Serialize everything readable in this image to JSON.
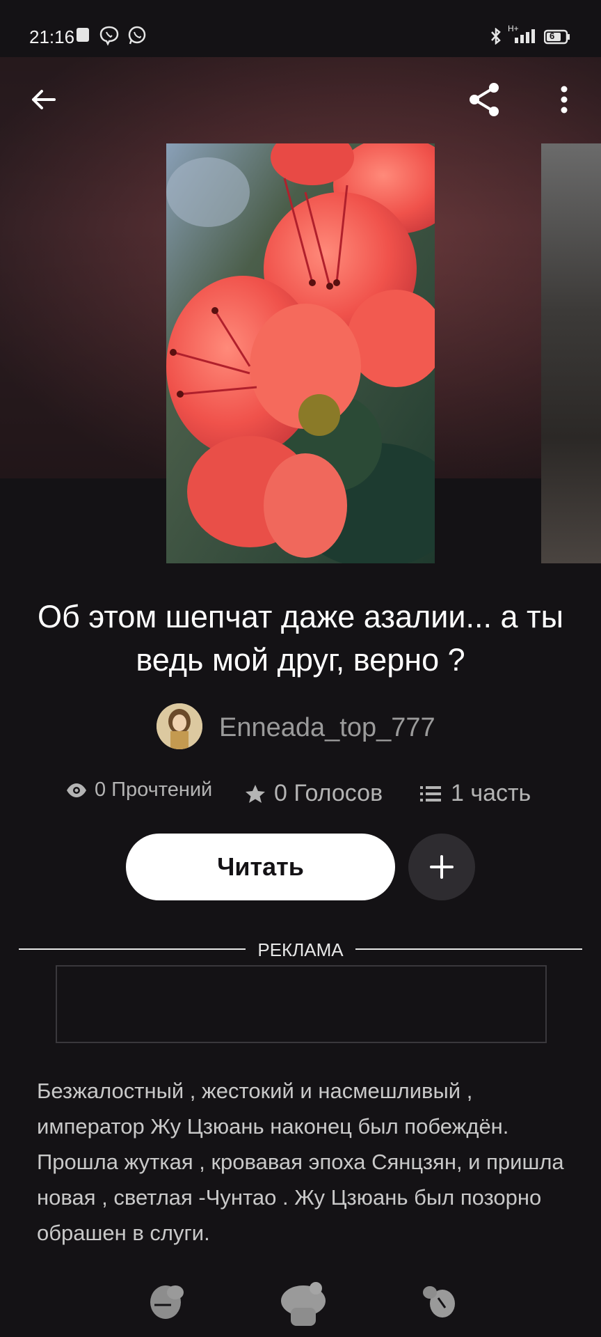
{
  "status_bar": {
    "time": "21:16",
    "network": "H+",
    "battery": "6"
  },
  "story": {
    "title": "Об этом шепчат даже азалии... а ты ведь мой друг, верно ?",
    "author": "Enneada_top_777",
    "reads": "0 Прочтений",
    "votes": "0 Голосов",
    "parts": "1 часть",
    "description": "Безжалостный ,  жестокий и насмешливый , император Жу Цзюань наконец был побеждён. Прошла жуткая , кровавая эпоха Сянцзян, и пришла новая , светлая -Чунтао . Жу Цзюань был позорно обрашен в слуги."
  },
  "actions": {
    "read_label": "Читать"
  },
  "ad": {
    "label": "РЕКЛАМА"
  },
  "icons": {
    "back": "arrow-left-icon",
    "share": "share-icon",
    "more": "more-vert-icon",
    "reads": "eye-icon",
    "votes": "star-icon",
    "parts": "list-icon",
    "add": "plus-icon"
  },
  "colors": {
    "background": "#141215",
    "primary_button": "#ffffff",
    "secondary_button": "#2e2c30"
  }
}
